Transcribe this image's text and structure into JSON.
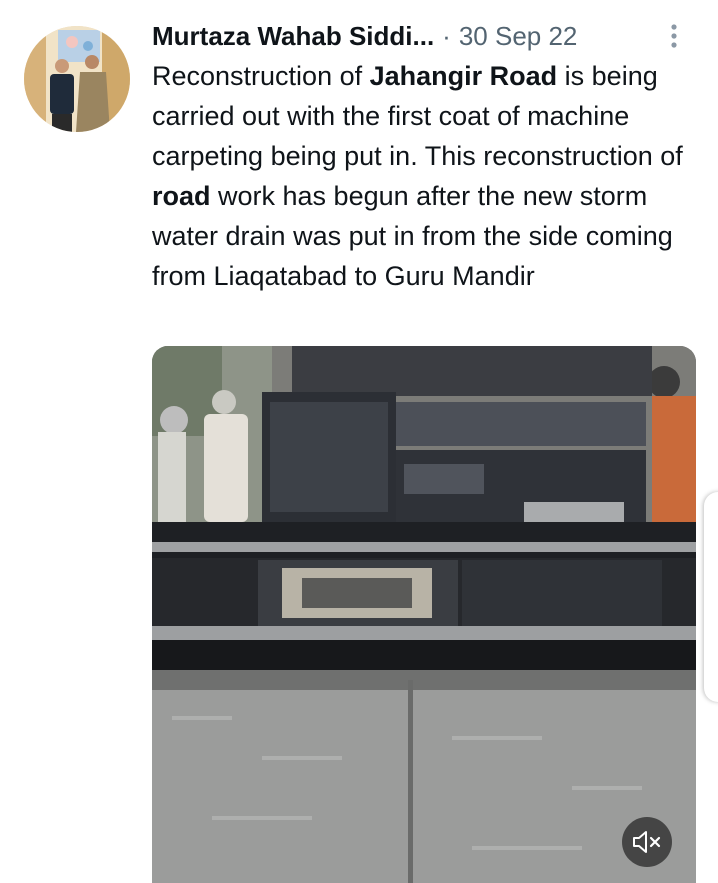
{
  "tweet": {
    "author_name": "Murtaza Wahab Siddi...",
    "separator": "·",
    "date": "30 Sep 22",
    "text_segments": [
      {
        "text": "Reconstruction of ",
        "bold": false
      },
      {
        "text": "Jahangir Road",
        "bold": true
      },
      {
        "text": " is being carried out with the first coat of machine carpeting being put in. This reconstruction of ",
        "bold": false
      },
      {
        "text": "road",
        "bold": true
      },
      {
        "text": " work has begun after the new storm water drain was put in from the side coming from Liaqatabad to Guru Mandir",
        "bold": false
      }
    ]
  },
  "icons": {
    "more": "more-vertical-icon",
    "mute": "volume-muted-icon"
  },
  "colors": {
    "text_primary": "#0f1419",
    "text_secondary": "#536471",
    "icon_gray": "#8b98a5"
  }
}
